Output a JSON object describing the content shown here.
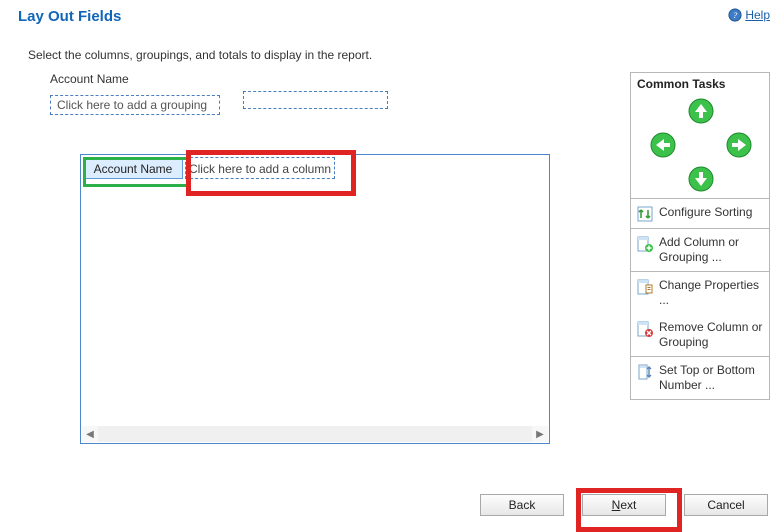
{
  "header": {
    "title": "Lay Out Fields",
    "help_label": "Help"
  },
  "subtitle": "Select the columns, groupings, and totals to display in the report.",
  "layout": {
    "field_label": "Account Name",
    "grouping_placeholder": "Click here to add a grouping",
    "column1": "Account Name",
    "add_column_placeholder": "Click here to add a column"
  },
  "tasks": {
    "title": "Common Tasks",
    "configure_sorting": "Configure Sorting",
    "add_column": "Add Column or Grouping ...",
    "change_properties": "Change Properties ...",
    "remove_column": "Remove Column or Grouping",
    "set_top": "Set Top or Bottom Number ..."
  },
  "footer": {
    "back": "Back",
    "next_prefix": "N",
    "next_rest": "ext",
    "cancel": "Cancel"
  }
}
